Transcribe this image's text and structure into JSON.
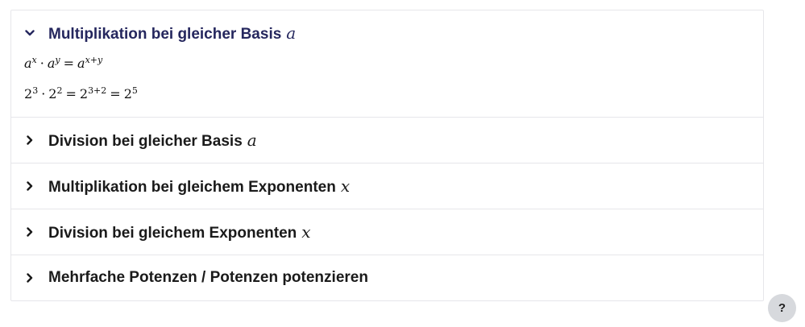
{
  "accordion": {
    "items": [
      {
        "title": "Multiplikation bei gleicher Basis",
        "var": "a",
        "expanded": true,
        "formula1": {
          "base": "a",
          "exp1": "x",
          "exp2": "y",
          "expSum": "x+y"
        },
        "formula2": {
          "base": "2",
          "exp1": "3",
          "exp2": "2",
          "expSum": "3+2",
          "result_exp": "5"
        }
      },
      {
        "title": "Division bei gleicher Basis",
        "var": "a",
        "expanded": false
      },
      {
        "title": "Multiplikation bei gleichem Exponenten",
        "var": "x",
        "expanded": false
      },
      {
        "title": "Division bei gleichem Exponenten",
        "var": "x",
        "expanded": false
      },
      {
        "title": "Mehrfache Potenzen / Potenzen potenzieren",
        "var": "",
        "expanded": false
      }
    ]
  },
  "help": {
    "label": "?"
  },
  "icons": {
    "expanded": "chevron-down-icon",
    "collapsed": "chevron-right-icon"
  },
  "colors": {
    "open_title": "#25275e",
    "title": "#1a1a1a",
    "border": "#e6e6ea",
    "help_bg": "#d7d9dd"
  }
}
